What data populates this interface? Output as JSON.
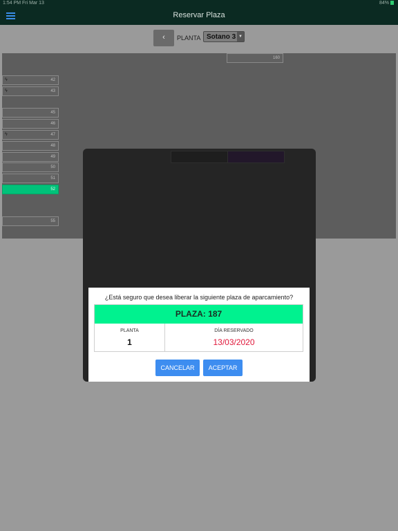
{
  "status_bar": {
    "time": "1:54 PM",
    "date": "Fri Mar 13",
    "battery": "84%"
  },
  "header": {
    "title": "Reservar Plaza"
  },
  "floor": {
    "back_label": "‹",
    "label": "PLANTA",
    "selected": "Sotano 3",
    "dropdown_arrow": "▼"
  },
  "spots": {
    "s160": "160",
    "s42": "42",
    "s43": "43",
    "s45": "45",
    "s46": "46",
    "s47": "47",
    "s48": "48",
    "s49": "49",
    "s50": "50",
    "s51": "51",
    "s52": "52",
    "s55": "55",
    "bolt": "ϟ",
    "selected_color": "#00c27a"
  },
  "dialog": {
    "question": "¿Está seguro que desea liberar la siguiente plaza de aparcamiento?",
    "plaza_text": "PLAZA: 187",
    "planta_label": "PLANTA",
    "planta_value": "1",
    "dia_label": "DÍA RESERVADO",
    "dia_value": "13/03/2020",
    "cancel_label": "CANCELAR",
    "accept_label": "ACEPTAR",
    "plaza_color": "#00f28f",
    "button_color": "#3d8df0",
    "date_color": "#e0173a"
  }
}
